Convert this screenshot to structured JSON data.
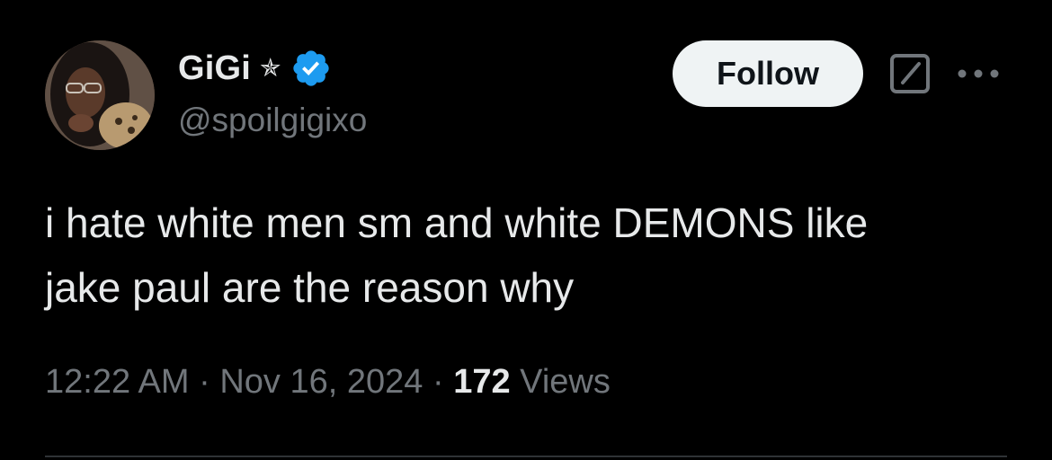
{
  "author": {
    "display_name": "GiGi",
    "star_symbol": "✯",
    "handle": "@spoilgigixo",
    "verified": true,
    "verified_color": "#1d9bf0",
    "avatar_icon": "profile-photo"
  },
  "actions": {
    "follow_label": "Follow",
    "grok_icon": "grok-slash-box-icon",
    "more_icon": "more-dots-icon"
  },
  "tweet": {
    "lines": [
      "i hate white men sm and white DEMONS like",
      "jake paul are the reason why"
    ]
  },
  "meta": {
    "time": "12:22 AM",
    "separator": "·",
    "date": "Nov 16, 2024",
    "views_count": "172",
    "views_label": "Views"
  },
  "colors": {
    "background": "#000000",
    "primary_text": "#e7e9ea",
    "secondary_text": "#71767b",
    "follow_bg": "#eff3f4",
    "divider": "#2f3336"
  }
}
